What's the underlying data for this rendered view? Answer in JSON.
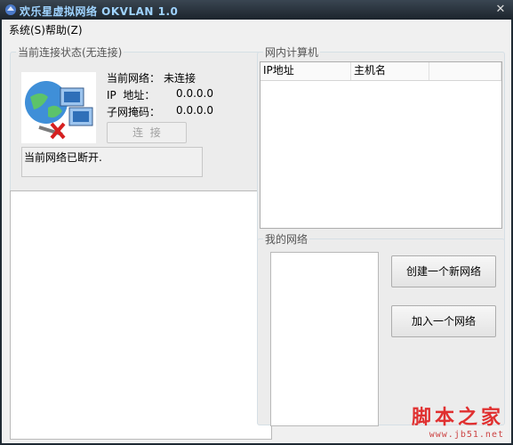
{
  "window": {
    "title": "欢乐星虚拟网络 OKVLAN 1.0",
    "close_glyph": "✕"
  },
  "menu": {
    "items": [
      {
        "label": "系统(S)"
      },
      {
        "label": "帮助(Z)"
      }
    ]
  },
  "status_panel": {
    "legend": "当前连接状态(无连接)",
    "network_label": "当前网络：",
    "network_value": "未连接",
    "ip_label": "IP  地址：",
    "ip_value": "0.0.0.0",
    "mask_label": "子网掩码：",
    "mask_value": "0.0.0.0",
    "connect_button": "连  接",
    "status_message": "当前网络已断开."
  },
  "lan_panel": {
    "legend": "网内计算机",
    "columns": [
      "IP地址",
      "主机名",
      ""
    ]
  },
  "my_network": {
    "legend": "我的网络",
    "create_button": "创建一个新网络",
    "join_button": "加入一个网络"
  },
  "watermark": {
    "brand": "脚本之家",
    "url": "www.jb51.net"
  },
  "colors": {
    "title_text": "#9fd3ff",
    "watermark": "#e03030"
  }
}
